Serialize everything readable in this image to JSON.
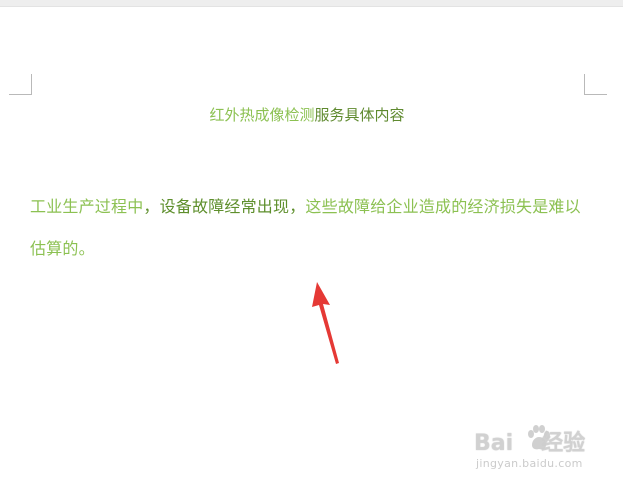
{
  "document": {
    "title_parts": [
      "红外热成像检测",
      "服务具体内容"
    ],
    "paragraph_parts": [
      "工业生产过程中",
      "，设备故障经常出现，",
      "这些故障给企业造成的经济损失是难以估算的。"
    ]
  },
  "watermark": {
    "brand_left": "Bai",
    "brand_right": "经验",
    "url": "jingyan.baidu.com"
  },
  "colors": {
    "text_green": "#8cc152",
    "text_dark_green": "#5e8f2c",
    "arrow_red": "#e53935"
  },
  "icons": {
    "annotation": "red-arrow-icon",
    "watermark_logo": "baidu-paw-icon"
  }
}
